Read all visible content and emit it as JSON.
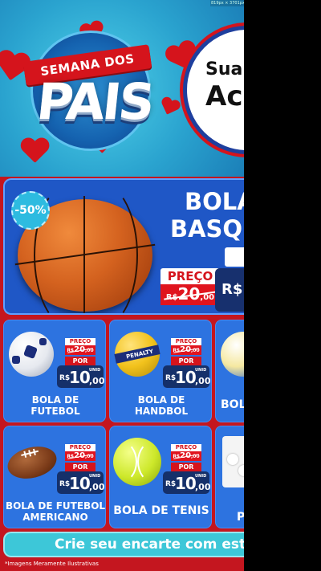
{
  "canvas_label": "819px × 3701px",
  "header": {
    "logo_banner": "SEMANA DOS",
    "logo_word": "PAIS",
    "offer_line1": "Sua",
    "offer_line2": "Ac"
  },
  "hero": {
    "discount": "-50%",
    "title_line1": "BOLA",
    "title_line2": "BASQ",
    "preco_label": "PREÇO",
    "old_price": "20",
    "old_cents": ",00",
    "old_prefix": "R$",
    "new_currency": "R$"
  },
  "products": [
    {
      "name_line1": "BOLA DE",
      "name_line2": "FUTEBOL",
      "preco_label": "PREÇO",
      "old_prefix": "R$",
      "old_price": "20",
      "old_cents": ",00",
      "por_label": "POR",
      "currency": "R$",
      "price": "10",
      "cents": ",00",
      "unit": "UNID",
      "icon": "soccer-ball-icon"
    },
    {
      "name_line1": "BOLA DE",
      "name_line2": "HANDBOL",
      "preco_label": "PREÇO",
      "old_prefix": "R$",
      "old_price": "20",
      "old_cents": ",00",
      "por_label": "POR",
      "currency": "R$",
      "price": "10",
      "cents": ",00",
      "unit": "UNID",
      "icon": "handball-icon"
    },
    {
      "name_line1": "BOL",
      "name_line2": "",
      "icon": "volleyball-icon"
    },
    {
      "name_line1": "BOLA DE FUTEBOL",
      "name_line2": "AMERICANO",
      "preco_label": "PREÇO",
      "old_prefix": "R$",
      "old_price": "20",
      "old_cents": ",00",
      "por_label": "POR",
      "currency": "R$",
      "price": "10",
      "cents": ",00",
      "unit": "UNID",
      "icon": "american-football-icon"
    },
    {
      "name_line1": "BOLA DE TENIS",
      "name_line2": "",
      "preco_label": "PREÇO",
      "old_prefix": "R$",
      "old_price": "20",
      "old_cents": ",00",
      "por_label": "POR",
      "currency": "R$",
      "price": "10",
      "cents": ",00",
      "unit": "UNID",
      "icon": "tennis-ball-icon"
    },
    {
      "name_line1": "P",
      "name_line2": "",
      "icon": "ping-pong-balls-icon"
    }
  ],
  "cta": {
    "label": "Crie seu encarte com este te"
  },
  "footer": {
    "disclaimer": "*Imagens Meramente Ilustrativas"
  },
  "colors": {
    "brand_red": "#d5141c",
    "brand_blue": "#1f57c6",
    "card_blue": "#2d73e0",
    "cta_cyan": "#3dc7d8"
  }
}
